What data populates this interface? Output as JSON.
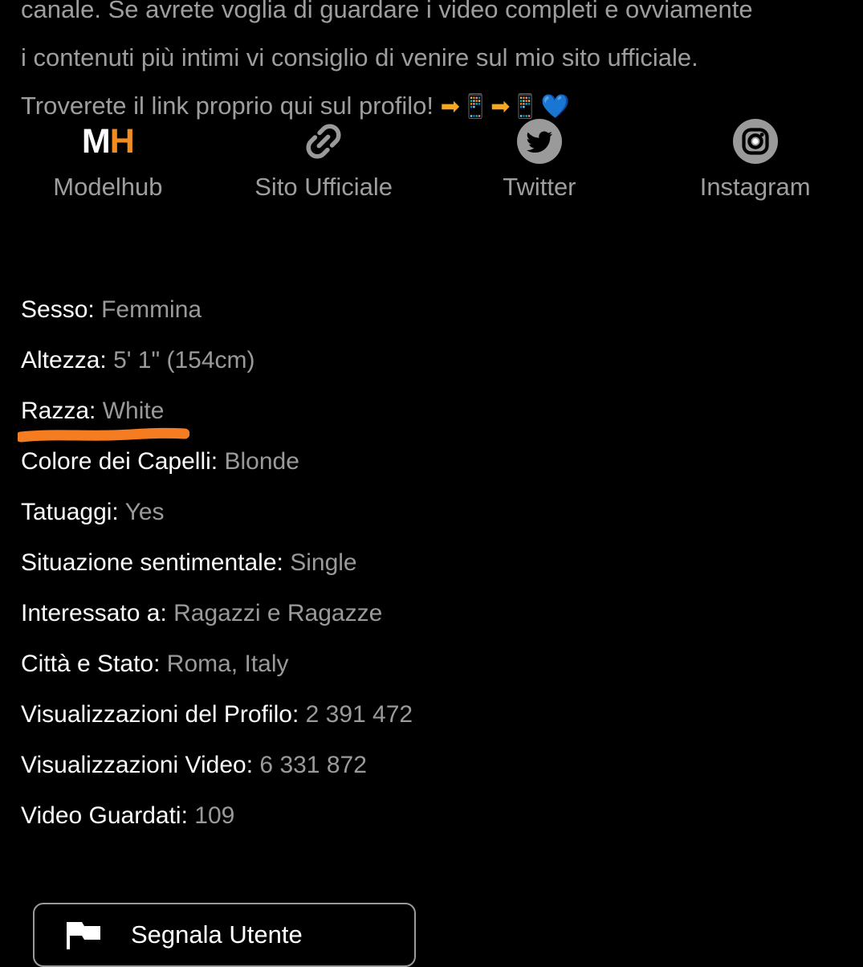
{
  "bio": {
    "lines": [
      "canale. Se avrete voglia di guardare i video completi e ovviamente",
      "i contenuti più intimi vi consiglio di venire sul mio sito ufficiale.",
      "Troverete il link proprio qui sul profilo!"
    ],
    "emoji_suffix": "➡📱➡📱💙"
  },
  "social": {
    "items": [
      {
        "label": "Modelhub",
        "icon": "modelhub-logo",
        "logo_first": "M",
        "logo_second": "H"
      },
      {
        "label": "Sito Ufficiale",
        "icon": "link-chain-icon"
      },
      {
        "label": "Twitter",
        "icon": "twitter-icon"
      },
      {
        "label": "Instagram",
        "icon": "instagram-icon"
      }
    ]
  },
  "details": {
    "rows": [
      {
        "label": "Sesso:",
        "value": "Femmina"
      },
      {
        "label": "Altezza:",
        "value": "5' 1\" (154cm)"
      },
      {
        "label": "Razza:",
        "value": "White"
      },
      {
        "label": "Colore dei Capelli:",
        "value": "Blonde"
      },
      {
        "label": "Tatuaggi:",
        "value": "Yes"
      },
      {
        "label": "Situazione sentimentale:",
        "value": "Single"
      },
      {
        "label": "Interessato a:",
        "value": "Ragazzi e Ragazze"
      },
      {
        "label": "Città e Stato:",
        "value": "Roma, Italy"
      },
      {
        "label": "Visualizzazioni del Profilo:",
        "value": "2 391 472"
      },
      {
        "label": "Visualizzazioni Video:",
        "value": "6 331 872"
      },
      {
        "label": "Video Guardati:",
        "value": "109"
      }
    ]
  },
  "annotation": {
    "underline_target": "Razza: White",
    "color": "#f57c20"
  },
  "report": {
    "label": "Segnala Utente",
    "icon": "flag-icon"
  },
  "colors": {
    "background": "#000000",
    "label_text": "#fbfbfb",
    "value_text": "#9a9a9a",
    "bio_text": "#9e9e9e",
    "accent_orange": "#f28b20",
    "marker_orange": "#f57c20",
    "twitter_circle": "#9a9a9a",
    "instagram_circle": "#9a9a9a",
    "button_border": "#9a9a9a"
  }
}
